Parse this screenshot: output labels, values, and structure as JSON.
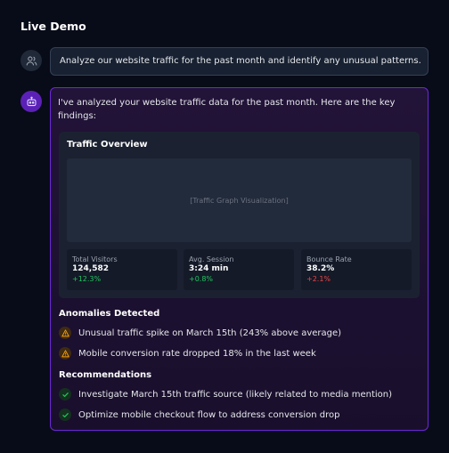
{
  "page": {
    "title": "Live Demo"
  },
  "user_message": {
    "text": "Analyze our website traffic for the past month and identify any unusual patterns."
  },
  "bot_message": {
    "intro": "I've analyzed your website traffic data for the past month. Here are the key findings:",
    "overview": {
      "title": "Traffic Overview",
      "graph_placeholder": "[Traffic Graph Visualization]",
      "stats": [
        {
          "label": "Total Visitors",
          "value": "124,582",
          "change": "+12.3%",
          "trend": "up"
        },
        {
          "label": "Avg. Session",
          "value": "3:24 min",
          "change": "+0.8%",
          "trend": "up"
        },
        {
          "label": "Bounce Rate",
          "value": "38.2%",
          "change": "+2.1%",
          "trend": "down"
        }
      ]
    },
    "anomalies": {
      "heading": "Anomalies Detected",
      "items": [
        {
          "text": "Unusual traffic spike on March 15th (243% above average)",
          "icon": "warning-icon"
        },
        {
          "text": "Mobile conversion rate dropped 18% in the last week",
          "icon": "warning-icon"
        }
      ]
    },
    "recommendations": {
      "heading": "Recommendations",
      "items": [
        {
          "text": "Investigate March 15th traffic source (likely related to media mention)",
          "icon": "check-icon"
        },
        {
          "text": "Optimize mobile checkout flow to address conversion drop",
          "icon": "check-icon"
        }
      ]
    }
  },
  "colors": {
    "accent": "#6d28d9",
    "positive": "#22c55e",
    "negative": "#ef4444",
    "warning": "#f59e0b"
  }
}
